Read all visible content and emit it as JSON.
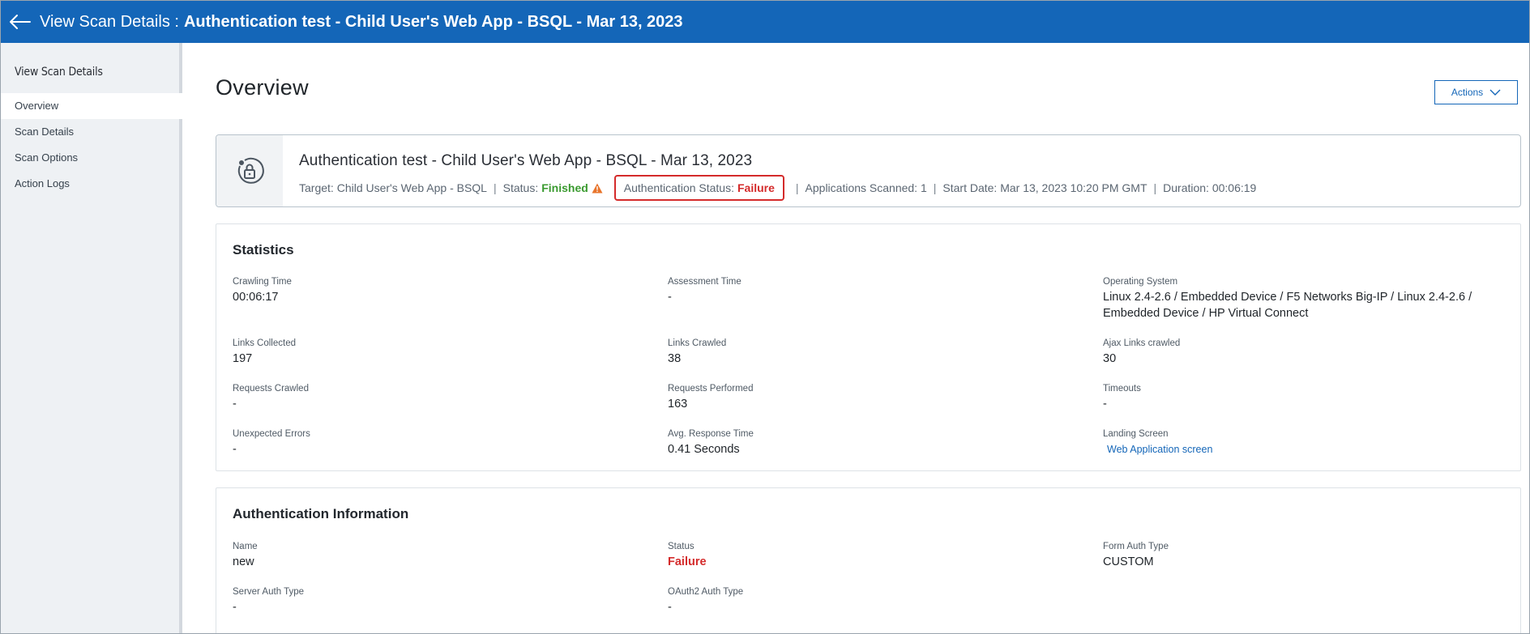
{
  "header": {
    "prefix": "View Scan Details :",
    "scan_name": "Authentication test - Child User's Web App - BSQL - Mar 13, 2023"
  },
  "sidebar": {
    "title": "View Scan Details",
    "items": [
      {
        "label": "Overview",
        "active": true
      },
      {
        "label": "Scan Details",
        "active": false
      },
      {
        "label": "Scan Options",
        "active": false
      },
      {
        "label": "Action Logs",
        "active": false
      }
    ]
  },
  "main": {
    "page_title": "Overview",
    "actions_label": "Actions"
  },
  "scan_card": {
    "name": "Authentication test - Child User's Web App - BSQL - Mar 13, 2023",
    "target_label": "Target:",
    "target_value": "Child User's Web App - BSQL",
    "status_label": "Status:",
    "status_value": "Finished",
    "auth_status_label": "Authentication Status:",
    "auth_status_value": "Failure",
    "apps_scanned": "Applications Scanned: 1",
    "start_date": "Start Date: Mar 13, 2023 10:20 PM GMT",
    "duration": "Duration: 00:06:19",
    "separator": "|"
  },
  "statistics": {
    "title": "Statistics",
    "fields": [
      {
        "label": "Crawling Time",
        "value": "00:06:17"
      },
      {
        "label": "Assessment Time",
        "value": "-"
      },
      {
        "label": "Operating System",
        "value": "Linux 2.4-2.6 / Embedded Device / F5 Networks Big-IP / Linux 2.4-2.6 / Embedded Device / HP Virtual Connect"
      },
      {
        "label": "Links Collected",
        "value": "197"
      },
      {
        "label": "Links Crawled",
        "value": "38"
      },
      {
        "label": "Ajax Links crawled",
        "value": "30"
      },
      {
        "label": "Requests Crawled",
        "value": "-"
      },
      {
        "label": "Requests Performed",
        "value": "163"
      },
      {
        "label": "Timeouts",
        "value": "-"
      },
      {
        "label": "Unexpected Errors",
        "value": "-"
      },
      {
        "label": "Avg. Response Time",
        "value": "0.41 Seconds"
      },
      {
        "label": "Landing Screen",
        "value": "Web Application screen"
      }
    ]
  },
  "auth_info": {
    "title": "Authentication Information",
    "fields": [
      {
        "label": "Name",
        "value": "new"
      },
      {
        "label": "Status",
        "value": "Failure"
      },
      {
        "label": "Form Auth Type",
        "value": "CUSTOM"
      },
      {
        "label": "Server Auth Type",
        "value": "-"
      },
      {
        "label": "OAuth2 Auth Type",
        "value": "-"
      }
    ]
  },
  "colors": {
    "header_bg": "#1466b8",
    "success": "#3a9a2f",
    "failure": "#d42b2b",
    "warning": "#e8742b",
    "link": "#1466b8"
  },
  "icons": {
    "back": "arrow-left-icon",
    "actions": "chevron-down-icon",
    "scan": "lock-scan-icon",
    "warning": "warning-triangle-icon"
  }
}
